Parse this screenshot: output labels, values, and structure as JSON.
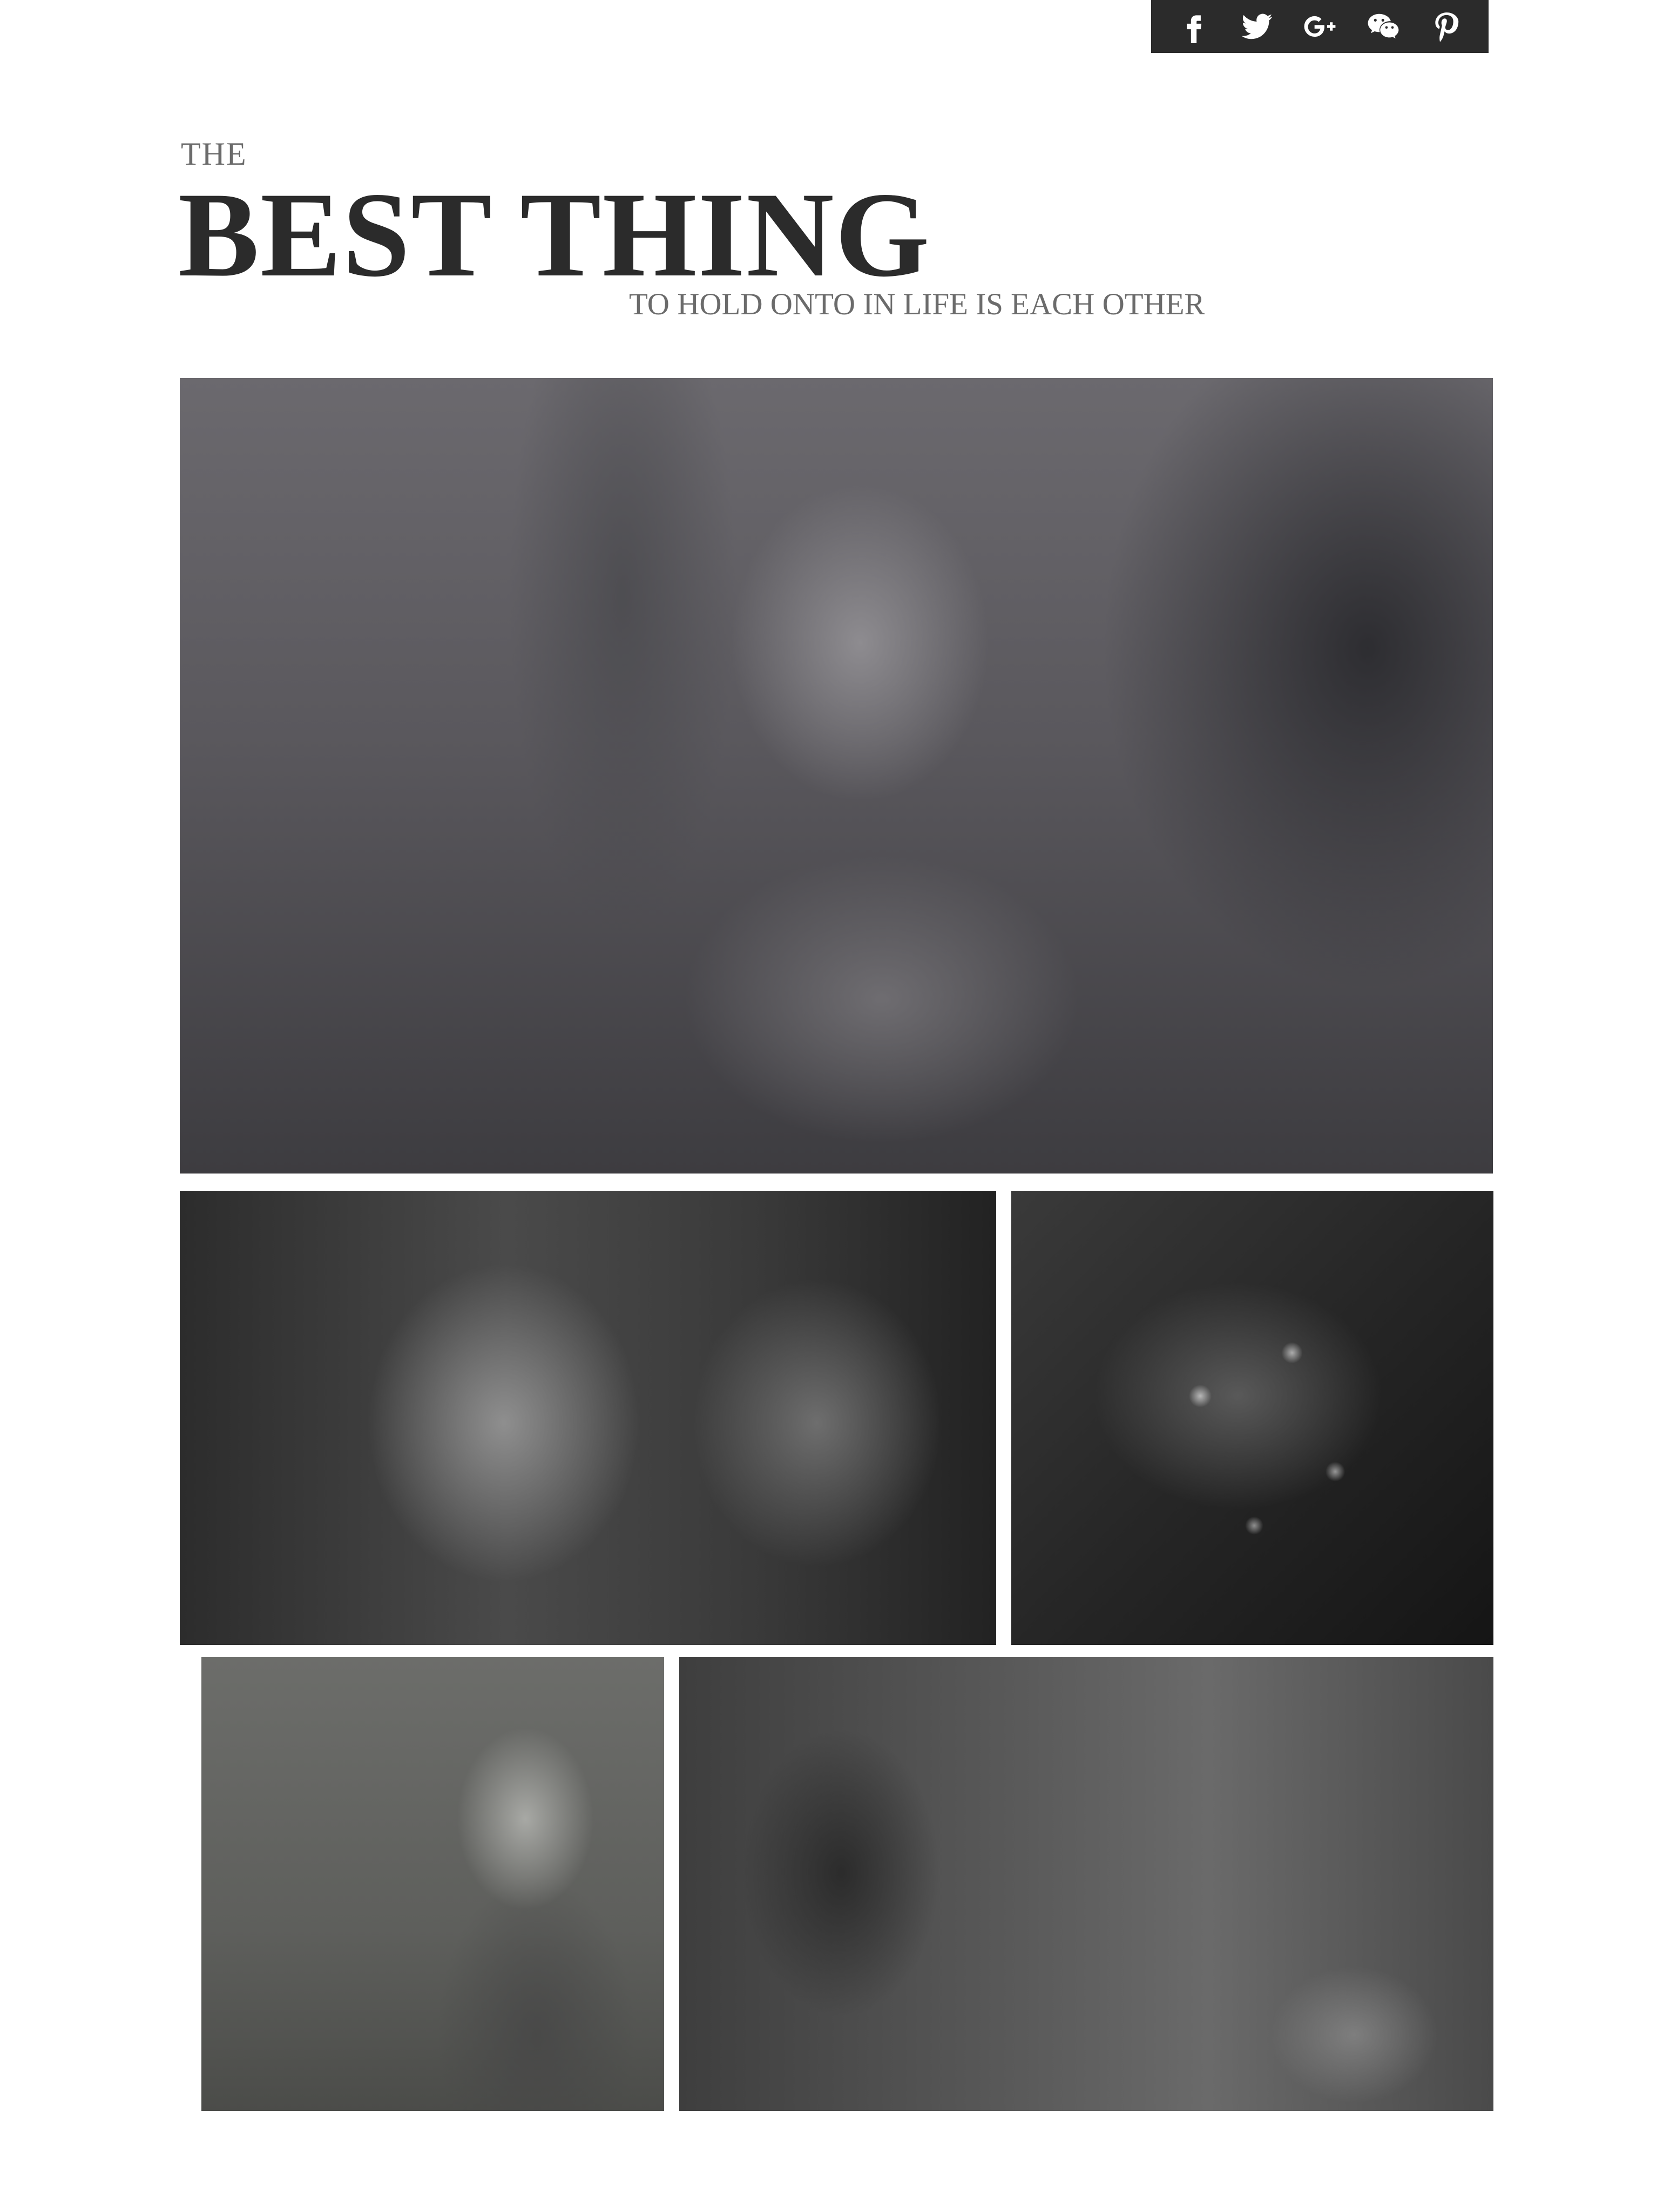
{
  "social": [
    {
      "name": "facebook-icon"
    },
    {
      "name": "twitter-icon"
    },
    {
      "name": "google-plus-icon"
    },
    {
      "name": "wechat-icon"
    },
    {
      "name": "pinterest-icon"
    }
  ],
  "header": {
    "kicker": "THE",
    "title": "BEST THING",
    "subtitle": "TO HOLD ONTO IN LIFE IS EACH OTHER"
  },
  "colors": {
    "social_bar": "#2b2b2b",
    "title": "#2b2b2b",
    "secondary_text": "#6b6b6b"
  }
}
